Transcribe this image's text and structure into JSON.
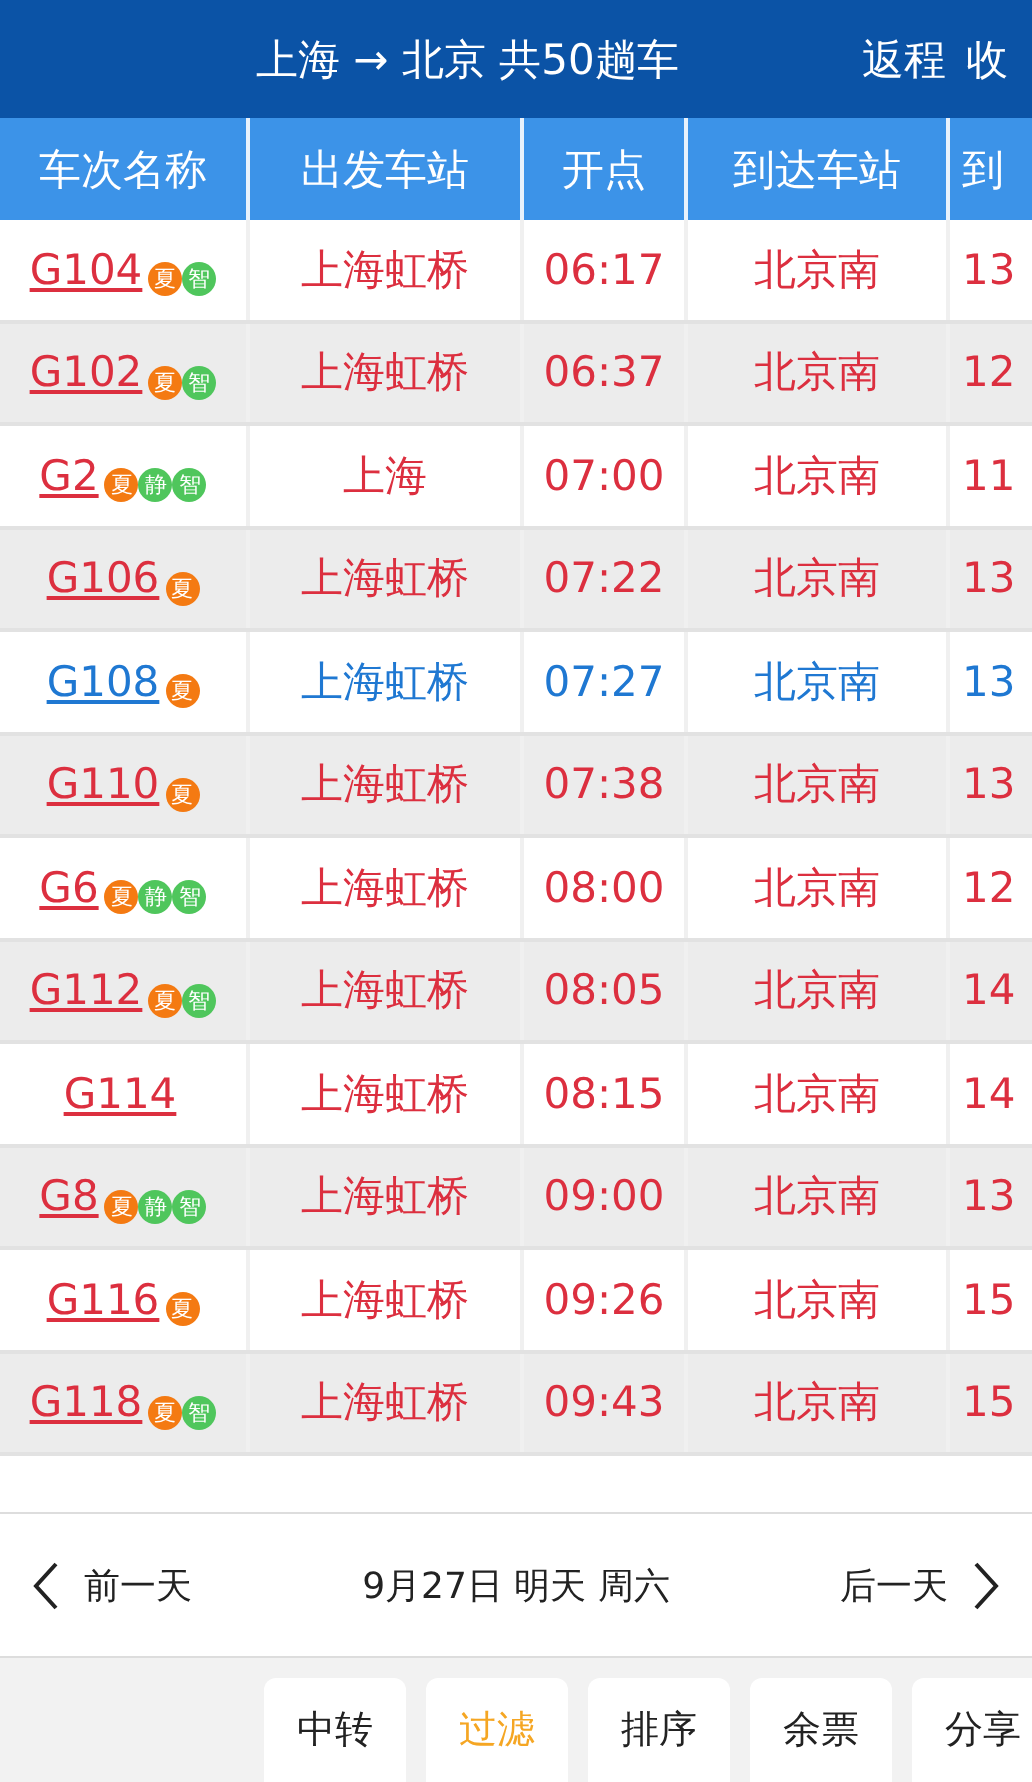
{
  "header": {
    "title": "上海 → 北京 共50趟车",
    "actions": [
      "返程",
      "收"
    ]
  },
  "columns": [
    "车次名称",
    "出发车站",
    "开点",
    "到达车站",
    "到"
  ],
  "rows": [
    {
      "train": "G104",
      "badges": [
        {
          "text": "夏",
          "color": "#f47a12"
        },
        {
          "text": "智",
          "color": "#4fc65c"
        }
      ],
      "from": "上海虹桥",
      "depart": "06:17",
      "to": "北京南",
      "column_5": "13",
      "highlighted": false
    },
    {
      "train": "G102",
      "badges": [
        {
          "text": "夏",
          "color": "#f47a12"
        },
        {
          "text": "智",
          "color": "#4fc65c"
        }
      ],
      "from": "上海虹桥",
      "depart": "06:37",
      "to": "北京南",
      "column_5": "12",
      "highlighted": false
    },
    {
      "train": "G2",
      "badges": [
        {
          "text": "夏",
          "color": "#f47a12"
        },
        {
          "text": "静",
          "color": "#4fc65c"
        },
        {
          "text": "智",
          "color": "#4fc65c"
        }
      ],
      "from": "上海",
      "depart": "07:00",
      "to": "北京南",
      "column_5": "11",
      "highlighted": false
    },
    {
      "train": "G106",
      "badges": [
        {
          "text": "夏",
          "color": "#f47a12"
        }
      ],
      "from": "上海虹桥",
      "depart": "07:22",
      "to": "北京南",
      "column_5": "13",
      "highlighted": false
    },
    {
      "train": "G108",
      "badges": [
        {
          "text": "夏",
          "color": "#f47a12"
        }
      ],
      "from": "上海虹桥",
      "depart": "07:27",
      "to": "北京南",
      "column_5": "13",
      "highlighted": true
    },
    {
      "train": "G110",
      "badges": [
        {
          "text": "夏",
          "color": "#f47a12"
        }
      ],
      "from": "上海虹桥",
      "depart": "07:38",
      "to": "北京南",
      "column_5": "13",
      "highlighted": false
    },
    {
      "train": "G6",
      "badges": [
        {
          "text": "夏",
          "color": "#f47a12"
        },
        {
          "text": "静",
          "color": "#4fc65c"
        },
        {
          "text": "智",
          "color": "#4fc65c"
        }
      ],
      "from": "上海虹桥",
      "depart": "08:00",
      "to": "北京南",
      "column_5": "12",
      "highlighted": false
    },
    {
      "train": "G112",
      "badges": [
        {
          "text": "夏",
          "color": "#f47a12"
        },
        {
          "text": "智",
          "color": "#4fc65c"
        }
      ],
      "from": "上海虹桥",
      "depart": "08:05",
      "to": "北京南",
      "column_5": "14",
      "highlighted": false
    },
    {
      "train": "G114",
      "badges": [],
      "from": "上海虹桥",
      "depart": "08:15",
      "to": "北京南",
      "column_5": "14",
      "highlighted": false
    },
    {
      "train": "G8",
      "badges": [
        {
          "text": "夏",
          "color": "#f47a12"
        },
        {
          "text": "静",
          "color": "#4fc65c"
        },
        {
          "text": "智",
          "color": "#4fc65c"
        }
      ],
      "from": "上海虹桥",
      "depart": "09:00",
      "to": "北京南",
      "column_5": "13",
      "highlighted": false
    },
    {
      "train": "G116",
      "badges": [
        {
          "text": "夏",
          "color": "#f47a12"
        }
      ],
      "from": "上海虹桥",
      "depart": "09:26",
      "to": "北京南",
      "column_5": "15",
      "highlighted": false
    },
    {
      "train": "G118",
      "badges": [
        {
          "text": "夏",
          "color": "#f47a12"
        },
        {
          "text": "智",
          "color": "#4fc65c"
        }
      ],
      "from": "上海虹桥",
      "depart": "09:43",
      "to": "北京南",
      "column_5": "15",
      "highlighted": false
    }
  ],
  "date_bar": {
    "prev": "前一天",
    "date": "9月27日 明天 周六",
    "next": "后一天"
  },
  "toolbar": [
    {
      "label": "中转",
      "selected": false
    },
    {
      "label": "过滤",
      "selected": true
    },
    {
      "label": "排序",
      "selected": false
    },
    {
      "label": "余票",
      "selected": false
    },
    {
      "label": "分享",
      "selected": false
    }
  ]
}
